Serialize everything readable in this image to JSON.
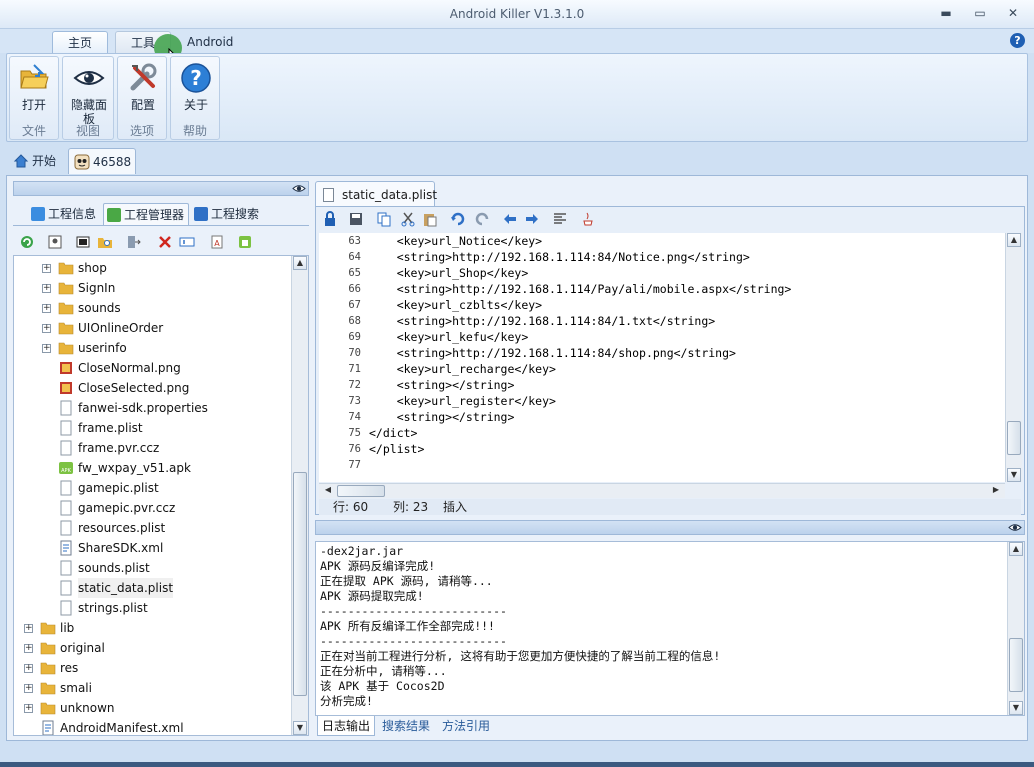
{
  "window": {
    "title": "Android Killer V1.3.1.0"
  },
  "ribbon": {
    "tabs": [
      "主页",
      "工具",
      "Android"
    ],
    "groups": [
      {
        "label": "文件",
        "buttons": [
          {
            "label": "打开",
            "icon": "open-folder-icon"
          }
        ]
      },
      {
        "label": "视图",
        "buttons": [
          {
            "label": "隐藏面板",
            "icon": "eye-icon"
          }
        ]
      },
      {
        "label": "选项",
        "buttons": [
          {
            "label": "配置",
            "icon": "tools-icon"
          }
        ]
      },
      {
        "label": "帮助",
        "buttons": [
          {
            "label": "关于",
            "icon": "help-icon"
          }
        ]
      }
    ]
  },
  "doc_tabs": [
    {
      "label": "开始",
      "icon": "home-icon"
    },
    {
      "label": "46588",
      "icon": "app-icon"
    }
  ],
  "left_panel": {
    "tabs": [
      "工程信息",
      "工程管理器",
      "工程搜索"
    ],
    "active_tab": "工程管理器",
    "tree": [
      {
        "label": "shop",
        "type": "folder",
        "level": 1,
        "expandable": true
      },
      {
        "label": "SignIn",
        "type": "folder",
        "level": 1,
        "expandable": true
      },
      {
        "label": "sounds",
        "type": "folder",
        "level": 1,
        "expandable": true
      },
      {
        "label": "UIOnlineOrder",
        "type": "folder",
        "level": 1,
        "expandable": true
      },
      {
        "label": "userinfo",
        "type": "folder",
        "level": 1,
        "expandable": true
      },
      {
        "label": "CloseNormal.png",
        "type": "image",
        "level": 1,
        "expandable": false
      },
      {
        "label": "CloseSelected.png",
        "type": "image",
        "level": 1,
        "expandable": false
      },
      {
        "label": "fanwei-sdk.properties",
        "type": "file",
        "level": 1,
        "expandable": false
      },
      {
        "label": "frame.plist",
        "type": "file",
        "level": 1,
        "expandable": false
      },
      {
        "label": "frame.pvr.ccz",
        "type": "file",
        "level": 1,
        "expandable": false
      },
      {
        "label": "fw_wxpay_v51.apk",
        "type": "apk",
        "level": 1,
        "expandable": false
      },
      {
        "label": "gamepic.plist",
        "type": "file",
        "level": 1,
        "expandable": false
      },
      {
        "label": "gamepic.pvr.ccz",
        "type": "file",
        "level": 1,
        "expandable": false
      },
      {
        "label": "resources.plist",
        "type": "file",
        "level": 1,
        "expandable": false
      },
      {
        "label": "ShareSDK.xml",
        "type": "xml",
        "level": 1,
        "expandable": false
      },
      {
        "label": "sounds.plist",
        "type": "file",
        "level": 1,
        "expandable": false
      },
      {
        "label": "static_data.plist",
        "type": "file",
        "level": 1,
        "expandable": false,
        "selected": true
      },
      {
        "label": "strings.plist",
        "type": "file",
        "level": 1,
        "expandable": false
      },
      {
        "label": "lib",
        "type": "folder",
        "level": 0,
        "expandable": true
      },
      {
        "label": "original",
        "type": "folder",
        "level": 0,
        "expandable": true
      },
      {
        "label": "res",
        "type": "folder",
        "level": 0,
        "expandable": true
      },
      {
        "label": "smali",
        "type": "folder",
        "level": 0,
        "expandable": true
      },
      {
        "label": "unknown",
        "type": "folder",
        "level": 0,
        "expandable": true
      },
      {
        "label": "AndroidManifest.xml",
        "type": "xml",
        "level": 0,
        "expandable": false
      }
    ]
  },
  "editor": {
    "tab_label": "static_data.plist",
    "lines": [
      {
        "n": "63",
        "text": "    <key>url_Notice</key>"
      },
      {
        "n": "64",
        "text": "    <string>http://192.168.1.114:84/Notice.png</string>"
      },
      {
        "n": "65",
        "text": "    <key>url_Shop</key>"
      },
      {
        "n": "66",
        "text": "    <string>http://192.168.1.114/Pay/ali/mobile.aspx</string>"
      },
      {
        "n": "67",
        "text": "    <key>url_czblts</key>"
      },
      {
        "n": "68",
        "text": "    <string>http://192.168.1.114:84/1.txt</string>"
      },
      {
        "n": "69",
        "text": "    <key>url_kefu</key>"
      },
      {
        "n": "70",
        "text": "    <string>http://192.168.1.114:84/shop.png</string>"
      },
      {
        "n": "71",
        "text": "    <key>url_recharge</key>"
      },
      {
        "n": "72",
        "text": "    <string></string>"
      },
      {
        "n": "73",
        "text": "    <key>url_register</key>"
      },
      {
        "n": "74",
        "text": "    <string></string>"
      },
      {
        "n": "75",
        "text": "</dict>"
      },
      {
        "n": "76",
        "text": "</plist>"
      },
      {
        "n": "77",
        "text": ""
      }
    ],
    "status": {
      "row": "行: 60",
      "col": "列: 23",
      "mode": "插入"
    }
  },
  "log": {
    "lines": [
      "-dex2jar.jar",
      "APK 源码反编译完成!",
      "正在提取 APK 源码, 请稍等...",
      "APK 源码提取完成!",
      "---------------------------",
      "APK 所有反编译工作全部完成!!!",
      "---------------------------",
      "正在对当前工程进行分析, 这将有助于您更加方便快捷的了解当前工程的信息!",
      "正在分析中, 请稍等...",
      "该 APK 基于 Cocos2D",
      "分析完成!"
    ],
    "tabs": [
      "日志输出",
      "搜索结果",
      "方法引用"
    ],
    "active_tab": "日志输出"
  },
  "colors": {
    "accent": "#1f5fb3",
    "folder": "#e8b43a",
    "panel": "#eaf1fa"
  }
}
